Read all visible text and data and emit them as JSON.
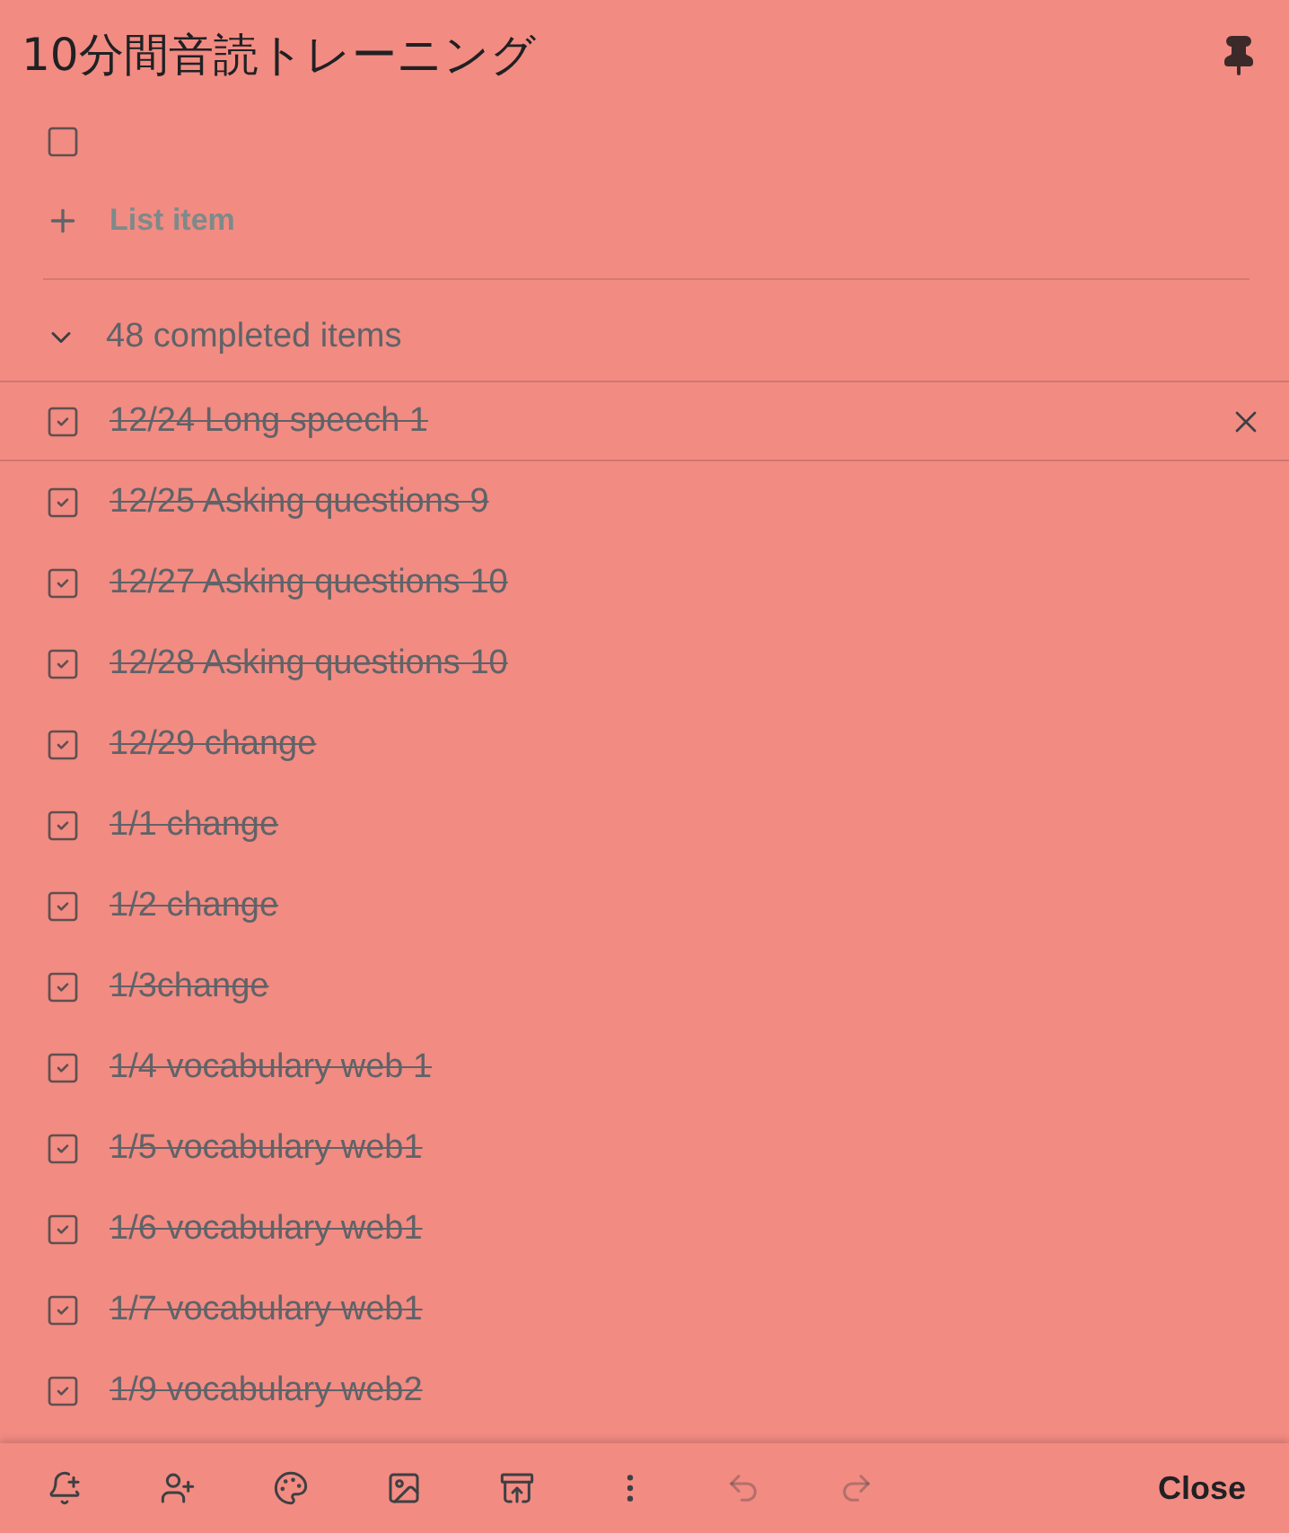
{
  "note": {
    "title": "10分間音読トレーニング"
  },
  "new_item": {
    "checked": false
  },
  "add_item": {
    "placeholder": "List item"
  },
  "completed": {
    "label": "48 completed items",
    "expanded": true,
    "items": [
      {
        "text": "12/24 Long speech 1",
        "checked": true,
        "selected": true
      },
      {
        "text": "12/25 Asking questions 9",
        "checked": true,
        "selected": false
      },
      {
        "text": "12/27 Asking questions 10",
        "checked": true,
        "selected": false
      },
      {
        "text": "12/28 Asking questions 10",
        "checked": true,
        "selected": false
      },
      {
        "text": "12/29 change",
        "checked": true,
        "selected": false
      },
      {
        "text": "1/1 change",
        "checked": true,
        "selected": false
      },
      {
        "text": "1/2 change ",
        "checked": true,
        "selected": false
      },
      {
        "text": "1/3change",
        "checked": true,
        "selected": false
      },
      {
        "text": "1/4 vocabulary web 1",
        "checked": true,
        "selected": false
      },
      {
        "text": "1/5 vocabulary web1",
        "checked": true,
        "selected": false
      },
      {
        "text": "1/6 vocabulary web1",
        "checked": true,
        "selected": false
      },
      {
        "text": "1/7 vocabulary web1",
        "checked": true,
        "selected": false
      },
      {
        "text": "1/9 vocabulary web2",
        "checked": true,
        "selected": false
      }
    ]
  },
  "toolbar": {
    "tools": [
      {
        "kind": "reminder",
        "disabled": false
      },
      {
        "kind": "collaborator",
        "disabled": false
      },
      {
        "kind": "color",
        "disabled": false
      },
      {
        "kind": "image",
        "disabled": false
      },
      {
        "kind": "archive",
        "disabled": false
      },
      {
        "kind": "more",
        "disabled": false
      },
      {
        "kind": "undo",
        "disabled": true
      },
      {
        "kind": "redo",
        "disabled": true
      }
    ],
    "close": "Close"
  }
}
